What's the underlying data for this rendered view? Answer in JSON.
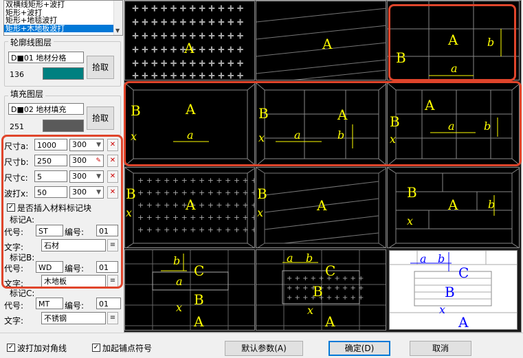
{
  "style_list": {
    "items": [
      "双横线矩形+波打",
      "矩形+波打",
      "矩形+地毯波打",
      "矩形+木地板波打"
    ],
    "selected_index": 3
  },
  "outline_layer": {
    "title": "轮廓线图层",
    "layer_name": "D■01 地材分格",
    "color_index": "136",
    "color": "#008080",
    "pick_label": "拾取"
  },
  "fill_layer": {
    "title": "填充图层",
    "layer_name": "D■02 地材填充",
    "color_index": "251",
    "color": "#5a5a5a",
    "pick_label": "拾取"
  },
  "dimensions": [
    {
      "label": "尺寸a:",
      "value": "1000",
      "combo": "300"
    },
    {
      "label": "尺寸b:",
      "value": "250",
      "combo": "300"
    },
    {
      "label": "尺寸c:",
      "value": "5",
      "combo": "300"
    },
    {
      "label": "波打x:",
      "value": "50",
      "combo": "300"
    }
  ],
  "insert_marker": {
    "label": "是否插入材料标记块",
    "checked": true
  },
  "markers": [
    {
      "title": "标记A:",
      "code_label": "代号:",
      "code": "ST",
      "num_label": "编号:",
      "num": "01",
      "text_label": "文字:",
      "text": "石材"
    },
    {
      "title": "标记B:",
      "code_label": "代号:",
      "code": "WD",
      "num_label": "编号:",
      "num": "01",
      "text_label": "文字:",
      "text": "木地板"
    },
    {
      "title": "标记C:",
      "code_label": "代号:",
      "code": "MT",
      "num_label": "编号:",
      "num": "01",
      "text_label": "文字:",
      "text": "不锈钢"
    }
  ],
  "bottom": {
    "corner_line": {
      "label": "波打加对角线",
      "checked": true
    },
    "start_symbol": {
      "label": "加起铺点符号",
      "checked": true
    },
    "default_params": "默认参数(A)",
    "ok": "确定(D)",
    "cancel": "取消"
  },
  "previews": {
    "labels": {
      "A": "A",
      "B": "B",
      "C": "C",
      "a": "a",
      "b": "b",
      "x": "x"
    }
  },
  "colors": {
    "highlight": "#e0452b",
    "selection": "#0078d7",
    "preview_text": "#ffff00"
  }
}
